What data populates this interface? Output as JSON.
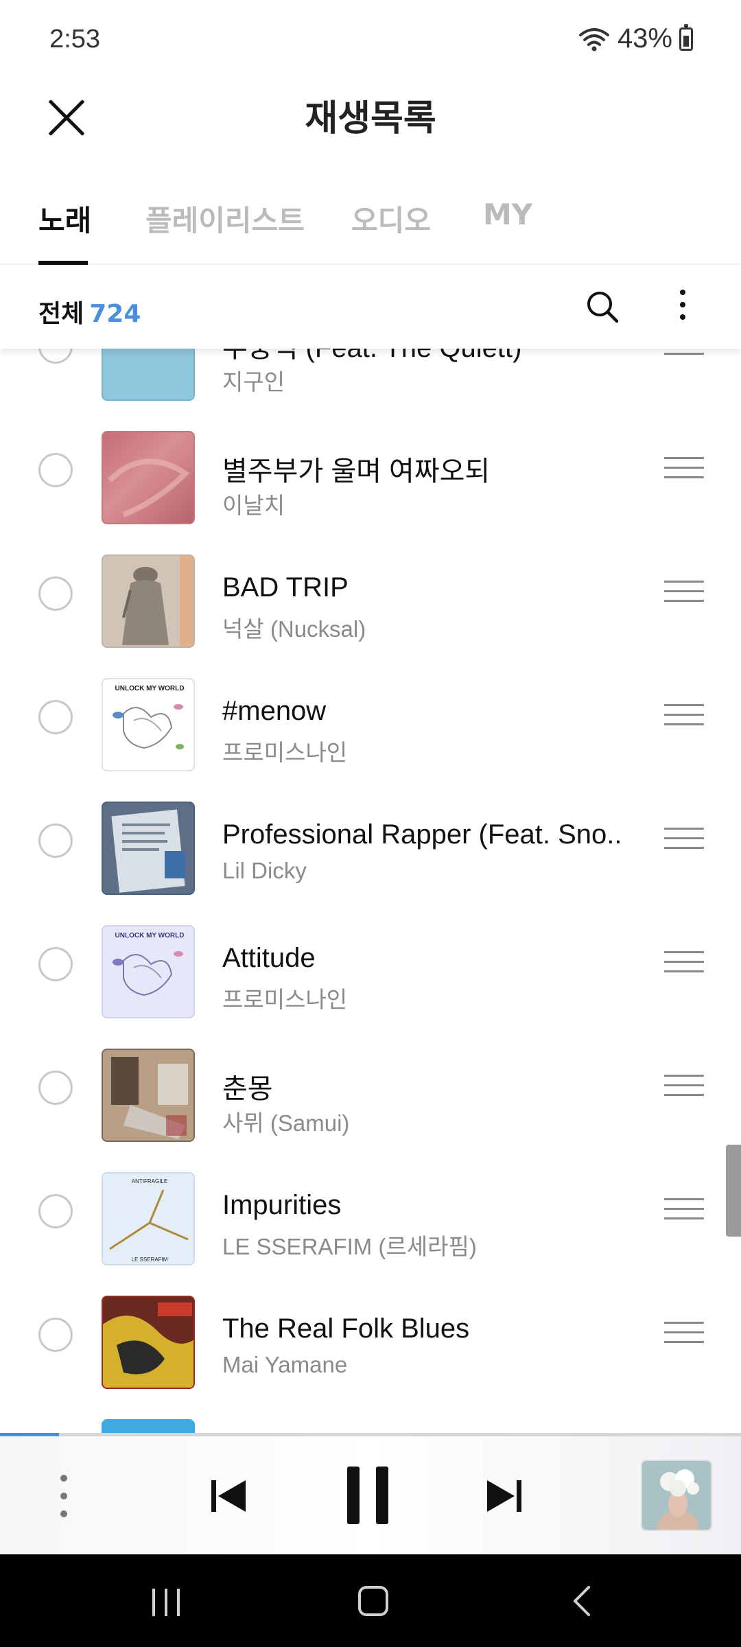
{
  "status_bar": {
    "time": "2:53",
    "battery": "43%"
  },
  "header": {
    "title": "재생목록"
  },
  "tabs": [
    {
      "label": "노래",
      "active": true
    },
    {
      "label": "플레이리스트",
      "active": false
    },
    {
      "label": "오디오",
      "active": false
    },
    {
      "label": "MY",
      "active": false
    }
  ],
  "filter": {
    "all_label": "전체",
    "count": "724"
  },
  "songs": [
    {
      "title": "무중력 (Feat. The Quiett)",
      "artist": "지구인"
    },
    {
      "title": "별주부가 울며 여짜오되",
      "artist": "이날치"
    },
    {
      "title": "BAD TRIP",
      "artist": "넉살 (Nucksal)"
    },
    {
      "title": "#menow",
      "artist": "프로미스나인"
    },
    {
      "title": "Professional Rapper (Feat. Sno..",
      "artist": "Lil Dicky"
    },
    {
      "title": "Attitude",
      "artist": "프로미스나인"
    },
    {
      "title": "춘몽",
      "artist": "사뮈 (Samui)"
    },
    {
      "title": "Impurities",
      "artist": "LE SSERAFIM (르세라핌)"
    },
    {
      "title": "The Real Folk Blues",
      "artist": "Mai Yamane"
    }
  ],
  "album_art_text": {
    "unlock_my_world": "UNLOCK MY WORLD",
    "antifragile_top": "ANTIFRAGILE",
    "antifragile_bottom": "LE SSERAFIM"
  },
  "player": {
    "progress": 0.08
  },
  "colors": {
    "accent": "#4a8ede",
    "text": "#111111",
    "secondary": "#8a8a8a"
  }
}
